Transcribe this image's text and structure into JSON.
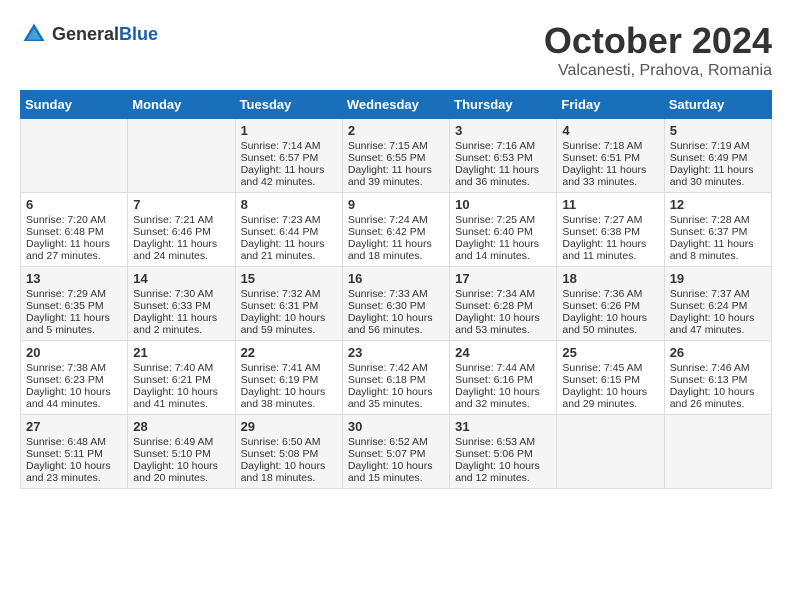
{
  "header": {
    "logo": {
      "general": "General",
      "blue": "Blue"
    },
    "month": "October 2024",
    "location": "Valcanesti, Prahova, Romania"
  },
  "weekdays": [
    "Sunday",
    "Monday",
    "Tuesday",
    "Wednesday",
    "Thursday",
    "Friday",
    "Saturday"
  ],
  "weeks": [
    [
      {
        "day": "",
        "content": ""
      },
      {
        "day": "",
        "content": ""
      },
      {
        "day": "1",
        "content": "Sunrise: 7:14 AM\nSunset: 6:57 PM\nDaylight: 11 hours and 42 minutes."
      },
      {
        "day": "2",
        "content": "Sunrise: 7:15 AM\nSunset: 6:55 PM\nDaylight: 11 hours and 39 minutes."
      },
      {
        "day": "3",
        "content": "Sunrise: 7:16 AM\nSunset: 6:53 PM\nDaylight: 11 hours and 36 minutes."
      },
      {
        "day": "4",
        "content": "Sunrise: 7:18 AM\nSunset: 6:51 PM\nDaylight: 11 hours and 33 minutes."
      },
      {
        "day": "5",
        "content": "Sunrise: 7:19 AM\nSunset: 6:49 PM\nDaylight: 11 hours and 30 minutes."
      }
    ],
    [
      {
        "day": "6",
        "content": "Sunrise: 7:20 AM\nSunset: 6:48 PM\nDaylight: 11 hours and 27 minutes."
      },
      {
        "day": "7",
        "content": "Sunrise: 7:21 AM\nSunset: 6:46 PM\nDaylight: 11 hours and 24 minutes."
      },
      {
        "day": "8",
        "content": "Sunrise: 7:23 AM\nSunset: 6:44 PM\nDaylight: 11 hours and 21 minutes."
      },
      {
        "day": "9",
        "content": "Sunrise: 7:24 AM\nSunset: 6:42 PM\nDaylight: 11 hours and 18 minutes."
      },
      {
        "day": "10",
        "content": "Sunrise: 7:25 AM\nSunset: 6:40 PM\nDaylight: 11 hours and 14 minutes."
      },
      {
        "day": "11",
        "content": "Sunrise: 7:27 AM\nSunset: 6:38 PM\nDaylight: 11 hours and 11 minutes."
      },
      {
        "day": "12",
        "content": "Sunrise: 7:28 AM\nSunset: 6:37 PM\nDaylight: 11 hours and 8 minutes."
      }
    ],
    [
      {
        "day": "13",
        "content": "Sunrise: 7:29 AM\nSunset: 6:35 PM\nDaylight: 11 hours and 5 minutes."
      },
      {
        "day": "14",
        "content": "Sunrise: 7:30 AM\nSunset: 6:33 PM\nDaylight: 11 hours and 2 minutes."
      },
      {
        "day": "15",
        "content": "Sunrise: 7:32 AM\nSunset: 6:31 PM\nDaylight: 10 hours and 59 minutes."
      },
      {
        "day": "16",
        "content": "Sunrise: 7:33 AM\nSunset: 6:30 PM\nDaylight: 10 hours and 56 minutes."
      },
      {
        "day": "17",
        "content": "Sunrise: 7:34 AM\nSunset: 6:28 PM\nDaylight: 10 hours and 53 minutes."
      },
      {
        "day": "18",
        "content": "Sunrise: 7:36 AM\nSunset: 6:26 PM\nDaylight: 10 hours and 50 minutes."
      },
      {
        "day": "19",
        "content": "Sunrise: 7:37 AM\nSunset: 6:24 PM\nDaylight: 10 hours and 47 minutes."
      }
    ],
    [
      {
        "day": "20",
        "content": "Sunrise: 7:38 AM\nSunset: 6:23 PM\nDaylight: 10 hours and 44 minutes."
      },
      {
        "day": "21",
        "content": "Sunrise: 7:40 AM\nSunset: 6:21 PM\nDaylight: 10 hours and 41 minutes."
      },
      {
        "day": "22",
        "content": "Sunrise: 7:41 AM\nSunset: 6:19 PM\nDaylight: 10 hours and 38 minutes."
      },
      {
        "day": "23",
        "content": "Sunrise: 7:42 AM\nSunset: 6:18 PM\nDaylight: 10 hours and 35 minutes."
      },
      {
        "day": "24",
        "content": "Sunrise: 7:44 AM\nSunset: 6:16 PM\nDaylight: 10 hours and 32 minutes."
      },
      {
        "day": "25",
        "content": "Sunrise: 7:45 AM\nSunset: 6:15 PM\nDaylight: 10 hours and 29 minutes."
      },
      {
        "day": "26",
        "content": "Sunrise: 7:46 AM\nSunset: 6:13 PM\nDaylight: 10 hours and 26 minutes."
      }
    ],
    [
      {
        "day": "27",
        "content": "Sunrise: 6:48 AM\nSunset: 5:11 PM\nDaylight: 10 hours and 23 minutes."
      },
      {
        "day": "28",
        "content": "Sunrise: 6:49 AM\nSunset: 5:10 PM\nDaylight: 10 hours and 20 minutes."
      },
      {
        "day": "29",
        "content": "Sunrise: 6:50 AM\nSunset: 5:08 PM\nDaylight: 10 hours and 18 minutes."
      },
      {
        "day": "30",
        "content": "Sunrise: 6:52 AM\nSunset: 5:07 PM\nDaylight: 10 hours and 15 minutes."
      },
      {
        "day": "31",
        "content": "Sunrise: 6:53 AM\nSunset: 5:06 PM\nDaylight: 10 hours and 12 minutes."
      },
      {
        "day": "",
        "content": ""
      },
      {
        "day": "",
        "content": ""
      }
    ]
  ]
}
